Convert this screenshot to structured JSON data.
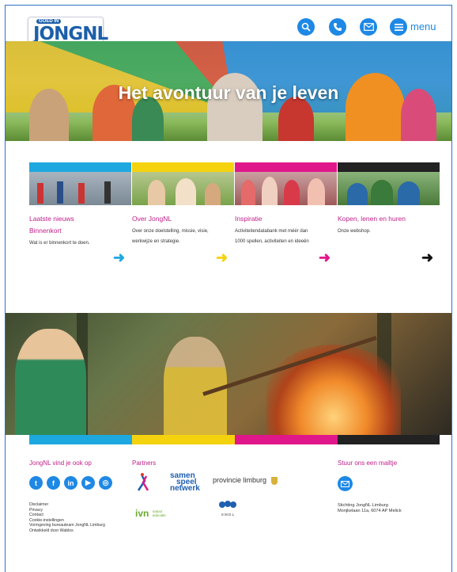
{
  "header": {
    "logo_small": "GOED IN",
    "logo_main": "JONGNL",
    "icons": [
      "search-icon",
      "phone-icon",
      "mail-icon",
      "hamburger-icon"
    ],
    "menu_label": "menu"
  },
  "hero": {
    "title": "Het avontuur van je leven"
  },
  "cards": [
    {
      "title_line1": "Laatste nieuws",
      "title_line2": "Binnenkort",
      "desc_line1": "Wat is er binnenkort te doen.",
      "desc_line2": "",
      "color": "#1ea8e0"
    },
    {
      "title_line1": "Over JongNL",
      "title_line2": "",
      "desc_line1": "Over onze doelstelling, missie, visie,",
      "desc_line2": "werkwijze en strategie.",
      "color": "#f5d20e"
    },
    {
      "title_line1": "Inspiratie",
      "title_line2": "",
      "desc_line1": "Activiteitendatabank met méér dan",
      "desc_line2": "1000 spellen, activiteiten en ideeën",
      "color": "#e0178a"
    },
    {
      "title_line1": "Kopen, lenen en huren",
      "title_line2": "",
      "desc_line1": "Onze webshop.",
      "desc_line2": "",
      "color": "#222222"
    }
  ],
  "footer": {
    "social_title": "JongNL vind je ook op",
    "partners_title": "Partners",
    "mail_title": "Stuur ons een mailtje",
    "social_icons": [
      "twitter-icon",
      "facebook-icon",
      "linkedin-icon",
      "youtube-icon",
      "instagram-icon"
    ],
    "partners": {
      "samen_1": "samen",
      "samen_2": "speel",
      "samen_3": "netwerk",
      "provincie": "provincie limburg",
      "ivn_1": "ivn",
      "ivn_2": "natuur",
      "ivn_3": "educatie",
      "smdl": "S M D L"
    },
    "links": [
      "Disclaimer",
      "Privacy",
      "Contact",
      "Cookie-instellingen",
      "Vormgeving bureauteam JongNL Limburg",
      "Ontwikkeld door Wablos"
    ],
    "address_line1": "Stichting JongNL Limburg",
    "address_line2": "Monjkelaan 11a, 6074 AP Melick"
  }
}
